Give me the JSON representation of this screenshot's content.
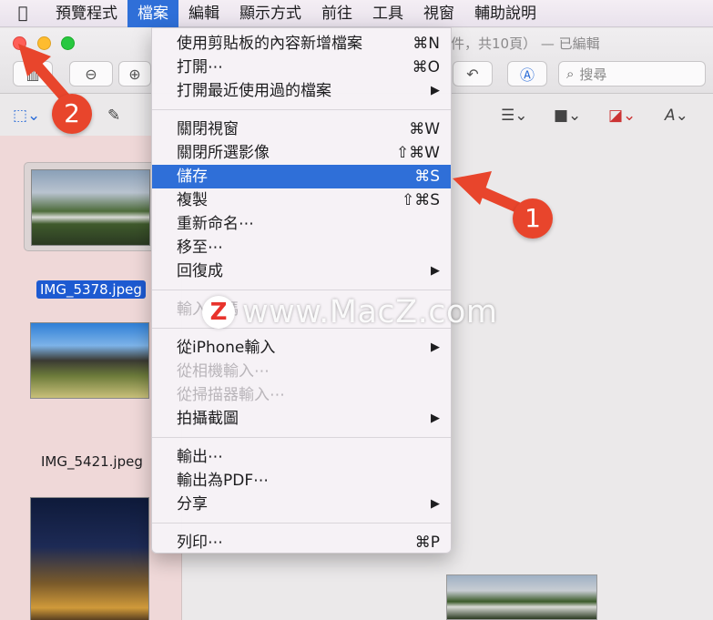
{
  "menubar": {
    "items": [
      "預覽程式",
      "檔案",
      "編輯",
      "顯示方式",
      "前往",
      "工具",
      "視窗",
      "輔助說明"
    ],
    "active_index": 1
  },
  "window": {
    "title_suffix": "件，共10頁） — 已編輯",
    "search_placeholder": "搜尋"
  },
  "file_menu": {
    "groups": [
      [
        {
          "label": "使用剪貼板的內容新增檔案",
          "shortcut": "⌘N"
        },
        {
          "label": "打開⋯",
          "shortcut": "⌘O"
        },
        {
          "label": "打開最近使用過的檔案",
          "shortcut": "▶"
        }
      ],
      [
        {
          "label": "關閉視窗",
          "shortcut": "⌘W"
        },
        {
          "label": "關閉所選影像",
          "shortcut": "⇧⌘W"
        },
        {
          "label": "儲存",
          "shortcut": "⌘S",
          "selected": true
        },
        {
          "label": "複製",
          "shortcut": "⇧⌘S"
        },
        {
          "label": "重新命名⋯",
          "shortcut": ""
        },
        {
          "label": "移至⋯",
          "shortcut": ""
        },
        {
          "label": "回復成",
          "shortcut": "▶"
        }
      ],
      [
        {
          "label": "輸入密碼",
          "shortcut": "",
          "disabled": true
        }
      ],
      [
        {
          "label": "從iPhone輸入",
          "shortcut": "▶"
        },
        {
          "label": "從相機輸入⋯",
          "shortcut": "",
          "disabled": true
        },
        {
          "label": "從掃描器輸入⋯",
          "shortcut": "",
          "disabled": true
        },
        {
          "label": "拍攝截圖",
          "shortcut": "▶"
        }
      ],
      [
        {
          "label": "輸出⋯",
          "shortcut": ""
        },
        {
          "label": "輸出為PDF⋯",
          "shortcut": ""
        },
        {
          "label": "分享",
          "shortcut": "▶"
        }
      ],
      [
        {
          "label": "列印⋯",
          "shortcut": "⌘P"
        }
      ]
    ]
  },
  "sidebar": {
    "thumbnails": [
      {
        "label": "IMG_5378.jpeg",
        "selected": true
      },
      {
        "label": "IMG_5421.jpeg",
        "selected": false
      }
    ]
  },
  "watermark": {
    "logo": "Z",
    "text": "www.MacZ.com"
  },
  "annotations": [
    "1",
    "2"
  ],
  "colors": {
    "accent": "#2f6fd8",
    "badge": "#e8452c"
  }
}
